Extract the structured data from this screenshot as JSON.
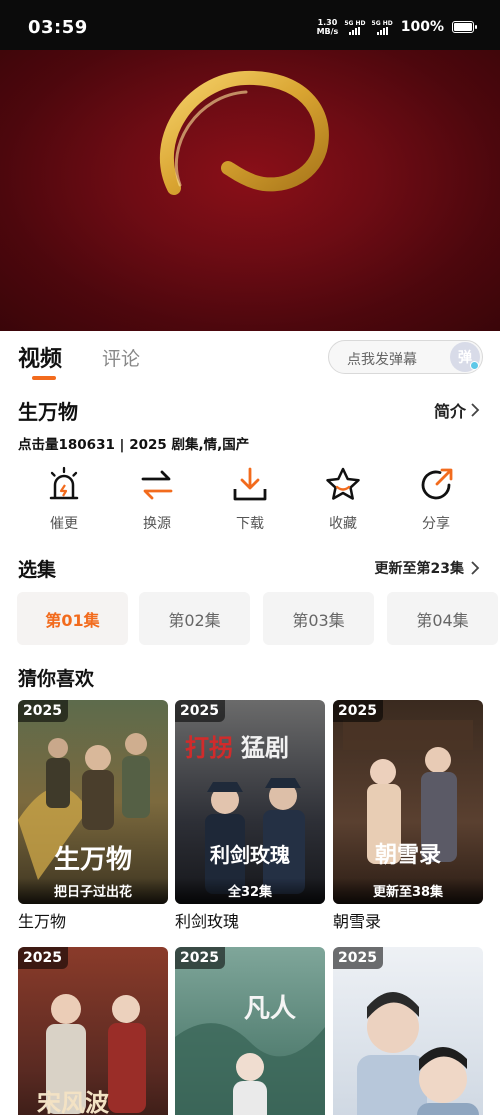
{
  "status_bar": {
    "time": "03:59",
    "net_speed_value": "1.30",
    "net_speed_unit": "MB/s",
    "sim1": "5G HD",
    "sim2": "5G HD",
    "battery": "100%"
  },
  "colors": {
    "accent": "#f26b1d",
    "player_bg": "#6e0c14"
  },
  "tabs": {
    "video": "视频",
    "comments": "评论"
  },
  "danmu": {
    "placeholder": "点我发弹幕",
    "button": "弹"
  },
  "show": {
    "title": "生万物",
    "intro_label": "简介",
    "meta": "点击量180631 | 2025 剧集,情,国产"
  },
  "actions": [
    {
      "label": "催更",
      "icon": "alarm-icon"
    },
    {
      "label": "换源",
      "icon": "swap-icon"
    },
    {
      "label": "下载",
      "icon": "download-icon"
    },
    {
      "label": "收藏",
      "icon": "star-icon"
    },
    {
      "label": "分享",
      "icon": "share-icon"
    }
  ],
  "episodes": {
    "title": "选集",
    "update": "更新至第23集",
    "items": [
      "第01集",
      "第02集",
      "第03集",
      "第04集"
    ],
    "selected": "第01集"
  },
  "recommend": {
    "title": "猜你喜欢",
    "cards": [
      {
        "year": "2025",
        "caption": "把日子过出花",
        "name": "生万物"
      },
      {
        "year": "2025",
        "caption": "全32集",
        "name": "利剑玫瑰"
      },
      {
        "year": "2025",
        "caption": "更新至38集",
        "name": "朝雪录"
      },
      {
        "year": "2025",
        "caption": "",
        "name": ""
      },
      {
        "year": "2025",
        "caption": "",
        "name": ""
      },
      {
        "year": "2025",
        "caption": "",
        "name": ""
      }
    ]
  }
}
